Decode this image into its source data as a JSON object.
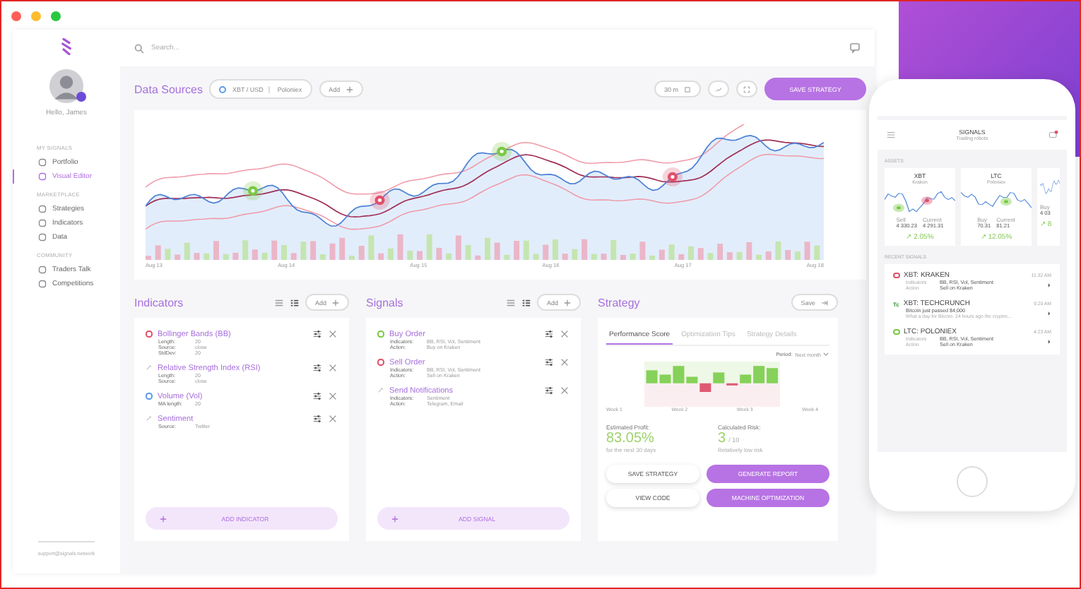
{
  "sidebar": {
    "user_name": "Hello, James",
    "sections": [
      {
        "title": "MY SIGNALS",
        "items": [
          {
            "label": "Portfolio",
            "selected": false
          },
          {
            "label": "Visual Editor",
            "selected": true
          }
        ]
      },
      {
        "title": "MARKETPLACE",
        "items": [
          {
            "label": "Strategies",
            "selected": false
          },
          {
            "label": "Indicators",
            "selected": false
          },
          {
            "label": "Data",
            "selected": false
          }
        ]
      },
      {
        "title": "COMMUNITY",
        "items": [
          {
            "label": "Traders Talk",
            "selected": false
          },
          {
            "label": "Competitions",
            "selected": false
          }
        ]
      }
    ],
    "footer": "support@signals.network"
  },
  "search": {
    "placeholder": "Search..."
  },
  "data_sources": {
    "title": "Data Sources",
    "pair": "XBT / USD",
    "exchange": "Poloniex",
    "add": "Add",
    "interval": "30 m",
    "save": "SAVE STRATEGY"
  },
  "price_chart": {
    "x_labels": [
      "Aug 13",
      "Aug 14",
      "Aug 15",
      "Aug 16",
      "Aug 17",
      "Aug 18"
    ]
  },
  "indicators": {
    "title": "Indicators",
    "add": "Add",
    "add_button": "ADD INDICATOR",
    "items": [
      {
        "name": "Bollinger Bands (BB)",
        "kind": "dot",
        "color": "#e0506a",
        "params": [
          {
            "label": "Length:",
            "value": "20"
          },
          {
            "label": "Source:",
            "value": "close"
          },
          {
            "label": "StdDev:",
            "value": "20"
          }
        ]
      },
      {
        "name": "Relative Strength Index (RSI)",
        "kind": "edit",
        "params": [
          {
            "label": "Length:",
            "value": "20"
          },
          {
            "label": "Source:",
            "value": "close"
          }
        ]
      },
      {
        "name": "Volume (Vol)",
        "kind": "dot",
        "color": "#5b9de8",
        "params": [
          {
            "label": "MA length:",
            "value": "20"
          }
        ]
      },
      {
        "name": "Sentiment",
        "kind": "edit",
        "params": [
          {
            "label": "Source:",
            "value": "Twitter"
          }
        ]
      }
    ]
  },
  "signals": {
    "title": "Signals",
    "add": "Add",
    "add_button": "ADD SIGNAL",
    "items": [
      {
        "name": "Buy Order",
        "kind": "dot",
        "color": "#7ac943",
        "params": [
          {
            "label": "Indicators:",
            "value": "BB, RSI, Vol, Sentiment"
          },
          {
            "label": "Action:",
            "value": "Buy on Kraken"
          }
        ]
      },
      {
        "name": "Sell Order",
        "kind": "dot",
        "color": "#e0506a",
        "params": [
          {
            "label": "Indicators:",
            "value": "BB, RSI, Vol, Sentiment"
          },
          {
            "label": "Action:",
            "value": "Sell on Kraken"
          }
        ]
      },
      {
        "name": "Send Notifications",
        "kind": "edit",
        "params": [
          {
            "label": "Indicators:",
            "value": "Sentiment"
          },
          {
            "label": "Action:",
            "value": "Telegram, Email"
          }
        ]
      }
    ]
  },
  "strategy": {
    "title": "Strategy",
    "save": "Save",
    "tabs": [
      {
        "label": "Performance Score",
        "selected": true
      },
      {
        "label": "Optimization Tips",
        "selected": false
      },
      {
        "label": "Strategy Details",
        "selected": false
      }
    ],
    "period_label": "Period:",
    "period": "Next month",
    "week_labels": [
      "Week 1",
      "Week 2",
      "Week 3",
      "Week 4"
    ],
    "metrics": [
      {
        "label": "Estimated Profit:",
        "value": "83.05%",
        "note": "for the next 30 days"
      },
      {
        "label": "Calculated Risk:",
        "value": "3",
        "suffix": "/ 10",
        "note": "Relatively low risk"
      }
    ],
    "buttons": [
      {
        "label": "SAVE STRATEGY",
        "kind": "outline"
      },
      {
        "label": "GENERATE REPORT",
        "kind": "filled"
      },
      {
        "label": "VIEW CODE",
        "kind": "outline"
      },
      {
        "label": "MACHINE OPTIMIZATION",
        "kind": "filled"
      }
    ]
  },
  "phone": {
    "title": "SIGNALS",
    "subtitle": "Trading robots",
    "assets_title": "ASSETS",
    "assets": [
      {
        "name": "XBT",
        "exchange": "Kraken",
        "stats": [
          {
            "label": "Sell",
            "value": "4 330.23"
          },
          {
            "label": "Current",
            "value": "4 291.31"
          }
        ],
        "change": "↗ 2.05%"
      },
      {
        "name": "LTC",
        "exchange": "Poloniex",
        "stats": [
          {
            "label": "Buy",
            "value": "70.31"
          },
          {
            "label": "Current",
            "value": "81.21"
          }
        ],
        "change": "↗ 12.05%"
      },
      {
        "stats": [
          {
            "label": "Buy",
            "value": "4 03"
          }
        ],
        "change": "↗ 8"
      }
    ],
    "recent_title": "RECENT SIGNALS",
    "recent": [
      {
        "kind": "dot",
        "color": "#e0506a",
        "title": "XBT: KRAKEN",
        "time": "11:32 AM",
        "lines": [
          {
            "label": "Indicators",
            "value": "BB, RSI, Vol, Sentiment"
          },
          {
            "label": "Action",
            "value": "Sell on Kraken"
          }
        ]
      },
      {
        "kind": "logo",
        "logo": "Tc",
        "title": "XBT: TECHCRUNCH",
        "time": "9:29 AM",
        "headline": "Bitcoin just passed $4,000",
        "excerpt": "What a day for Bitcoin. 24 hours ago the cryptoc..."
      },
      {
        "kind": "dot",
        "color": "#7ac943",
        "title": "LTC: POLONIEX",
        "time": "4:23 AM",
        "lines": [
          {
            "label": "Indicators",
            "value": "BB, RSI, Vol, Sentiment"
          },
          {
            "label": "Action",
            "value": "Sell on Kraken"
          }
        ]
      }
    ]
  }
}
